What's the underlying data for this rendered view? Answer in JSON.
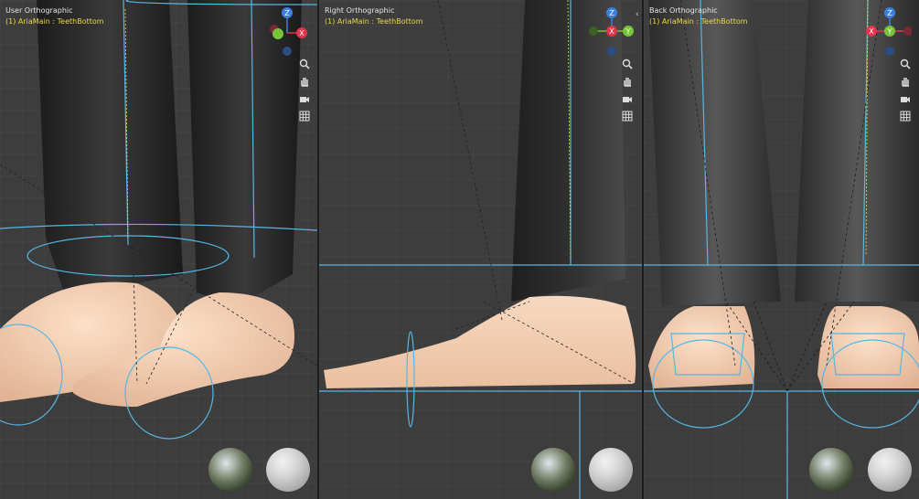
{
  "viewports": [
    {
      "id": "user",
      "title": "User Orthographic",
      "subtitle": "(1) AriaMain : TeethBottom",
      "gizmo": {
        "top": "Z",
        "left": "",
        "right": "X"
      }
    },
    {
      "id": "right",
      "title": "Right Orthographic",
      "subtitle": "(1) AriaMain : TeethBottom",
      "gizmo": {
        "top": "Z",
        "left": "",
        "center": "X",
        "right": "Y"
      }
    },
    {
      "id": "back",
      "title": "Back Orthographic",
      "subtitle": "(1) AriaMain : TeethBottom",
      "gizmo": {
        "top": "Z",
        "left": "X",
        "center": "Y",
        "right": ""
      }
    }
  ],
  "nav_icons": [
    "zoom-icon",
    "hand-pan-icon",
    "camera-icon",
    "grid-icon"
  ],
  "colors": {
    "axis_x": "#e3344b",
    "axis_y": "#77c33a",
    "axis_z": "#3b7fe0",
    "rig_lines": "#55b7e6",
    "skin": "#f2cdb0",
    "pants": "#2c2c2c",
    "grid": "#474747"
  },
  "balls": [
    "hdri-preview-ball",
    "clay-preview-ball"
  ]
}
